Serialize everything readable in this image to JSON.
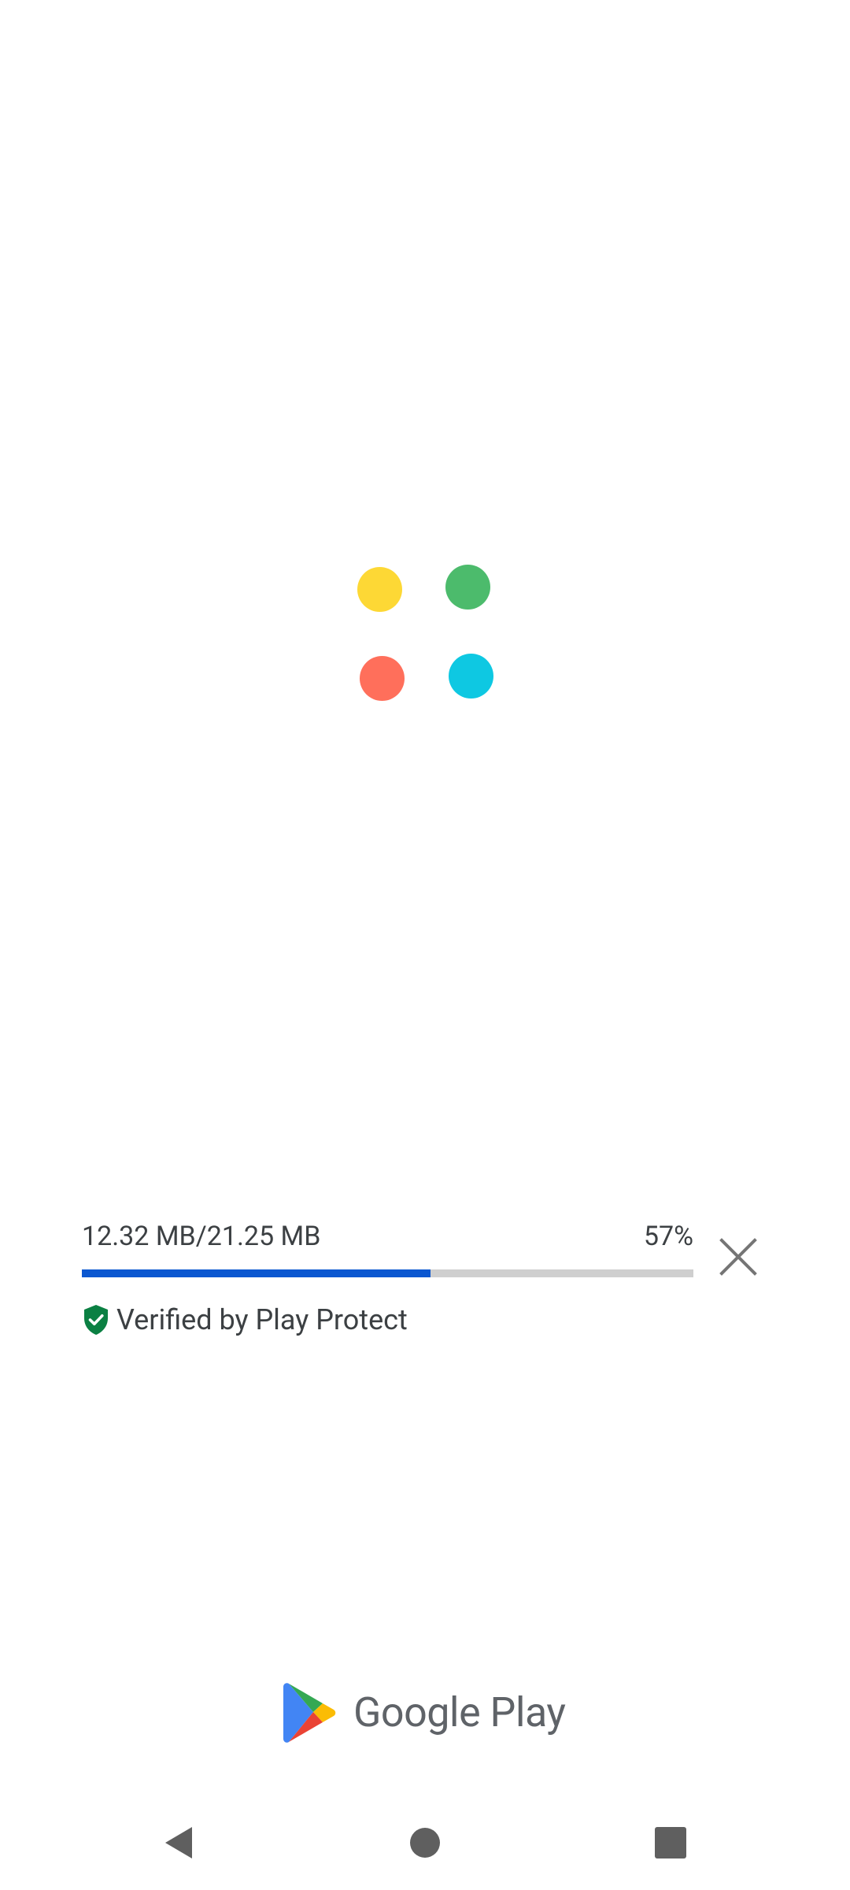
{
  "app_logo": {
    "icon": "app-loading-dots-icon",
    "dots": [
      {
        "name": "yellow-dot",
        "color": "#FDD835"
      },
      {
        "name": "green-dot",
        "color": "#4CBB6C"
      },
      {
        "name": "red-dot",
        "color": "#FF6F5B"
      },
      {
        "name": "blue-dot",
        "color": "#0EC8E2"
      }
    ]
  },
  "download": {
    "size_progress": "12.32 MB/21.25 MB",
    "percent": "57%",
    "progress_value": 0.57,
    "progress_color": "#0B57D0",
    "track_color": "#CFCFCF",
    "cancel_icon": "close-icon",
    "verified_text": "Verified by Play Protect",
    "verified_icon": "shield-check-icon",
    "verified_color": "#0B8043"
  },
  "brand": {
    "name": "Google Play",
    "icon": "google-play-logo-icon"
  },
  "navigation": {
    "back_icon": "back-triangle-icon",
    "home_icon": "home-circle-icon",
    "recent_icon": "recent-apps-square-icon"
  }
}
